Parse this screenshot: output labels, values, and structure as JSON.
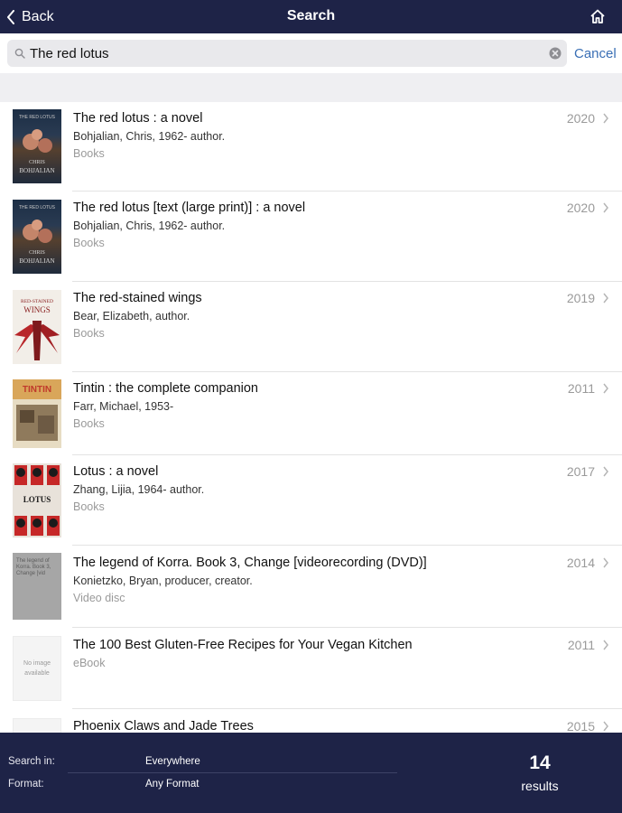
{
  "nav": {
    "back_label": "Back",
    "title": "Search",
    "home_icon": "home-icon"
  },
  "search": {
    "query": "The red lotus",
    "cancel_label": "Cancel"
  },
  "results": [
    {
      "title": "The red lotus : a novel",
      "author": "Bohjalian, Chris, 1962- author.",
      "format": "Books",
      "year": "2020",
      "cover_lines": [
        "CHRIS",
        "BOHJALIAN"
      ],
      "cover_top": "THE RED LOTUS"
    },
    {
      "title": "The red lotus [text (large print)] : a novel",
      "author": "Bohjalian, Chris, 1962- author.",
      "format": "Books",
      "year": "2020",
      "cover_lines": [
        "CHRIS",
        "BOHJALIAN"
      ],
      "cover_top": "THE RED LOTUS"
    },
    {
      "title": "The red-stained wings",
      "author": "Bear, Elizabeth, author.",
      "format": "Books",
      "year": "2019",
      "cover_lines": [
        "RED-STAINED",
        "WINGS"
      ]
    },
    {
      "title": "Tintin : the complete companion",
      "author": "Farr, Michael, 1953-",
      "format": "Books",
      "year": "2011",
      "cover_lines": [
        "TINTIN"
      ]
    },
    {
      "title": "Lotus : a novel",
      "author": "Zhang, Lijia, 1964- author.",
      "format": "Books",
      "year": "2017",
      "cover_lines": [
        "LOTUS"
      ]
    },
    {
      "title": "The legend of Korra. Book 3, Change [videorecording (DVD)]",
      "author": "Konietzko, Bryan, producer, creator.",
      "format": "Video disc",
      "year": "2014",
      "cover_lines": [
        "The legend of",
        "Korra. Book 3,",
        "Change [vid"
      ]
    },
    {
      "title": "The 100 Best Gluten-Free Recipes for Your Vegan Kitchen",
      "author": "",
      "format": "eBook",
      "year": "2011",
      "cover_lines": [
        "No image",
        "available"
      ]
    },
    {
      "title": "Phoenix Claws and Jade Trees",
      "author": "",
      "format": "",
      "year": "2015",
      "cover_lines": []
    }
  ],
  "footer": {
    "search_in_label": "Search in:",
    "search_in_value": "Everywhere",
    "format_label": "Format:",
    "format_value": "Any Format",
    "count": "14",
    "count_label": "results"
  },
  "colors": {
    "navbar": "#1e2347",
    "accent": "#3a6fb5"
  }
}
